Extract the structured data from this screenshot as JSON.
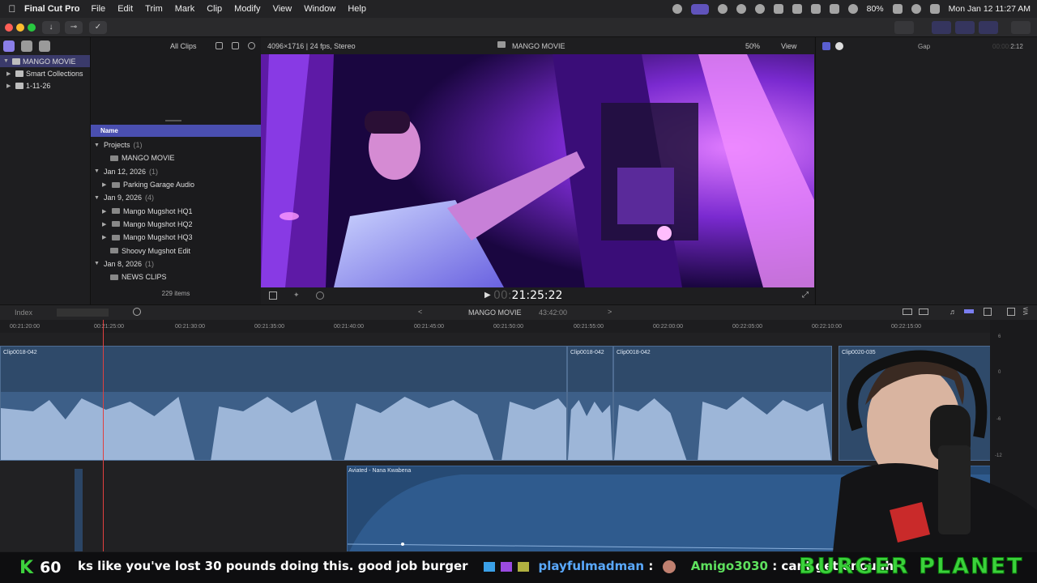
{
  "menubar": {
    "app_name": "Final Cut Pro",
    "menus": [
      "File",
      "Edit",
      "Trim",
      "Mark",
      "Clip",
      "Modify",
      "View",
      "Window",
      "Help"
    ],
    "battery": "80%",
    "clock": "Mon Jan 12  11:27 AM"
  },
  "library": {
    "items": [
      {
        "label": "MANGO MOVIE",
        "selected": true
      },
      {
        "label": "Smart Collections",
        "selected": false
      },
      {
        "label": "1-11-26",
        "selected": false
      }
    ]
  },
  "browser": {
    "filter": "All Clips",
    "column_header": "Name",
    "rows": [
      {
        "label": "Projects",
        "count": "(1)",
        "kind": "group"
      },
      {
        "label": "MANGO MOVIE",
        "count": "",
        "kind": "project"
      },
      {
        "label": "Jan 12, 2026",
        "count": "(1)",
        "kind": "group"
      },
      {
        "label": "Parking Garage Audio",
        "count": "",
        "kind": "clip"
      },
      {
        "label": "Jan 9, 2026",
        "count": "(4)",
        "kind": "group"
      },
      {
        "label": "Mango Mugshot HQ1",
        "count": "",
        "kind": "clip"
      },
      {
        "label": "Mango Mugshot HQ2",
        "count": "",
        "kind": "clip"
      },
      {
        "label": "Mango Mugshot HQ3",
        "count": "",
        "kind": "clip"
      },
      {
        "label": "Shoovy Mugshot Edit",
        "count": "",
        "kind": "project"
      },
      {
        "label": "Jan 8, 2026",
        "count": "(1)",
        "kind": "group"
      },
      {
        "label": "NEWS CLIPS",
        "count": "",
        "kind": "project"
      }
    ],
    "footer": "229 items"
  },
  "viewer": {
    "format": "4096×1716 | 24 fps, Stereo",
    "title": "MANGO MOVIE",
    "zoom": "50%",
    "view_label": "View",
    "timecode_dim": "00:",
    "timecode": "21:25:22"
  },
  "inspector": {
    "title": "Gap",
    "duration_dim": "00:00:",
    "duration": "2:12"
  },
  "timeline": {
    "index_label": "Index",
    "project": "MANGO MOVIE",
    "duration": "43:42:00",
    "ruler_labels": [
      "00:21:20:00",
      "00:21:25:00",
      "00:21:30:00",
      "00:21:35:00",
      "00:21:40:00",
      "00:21:45:00",
      "00:21:50:00",
      "00:21:55:00",
      "00:22:00:00",
      "00:22:05:00",
      "00:22:10:00",
      "00:22:15:00"
    ],
    "clips": [
      {
        "name": "Clip0018-042"
      },
      {
        "name": "Clip0018-042"
      },
      {
        "name": "Clip0018-042"
      },
      {
        "name": "Clip0020-035"
      }
    ],
    "music_clip": "Aviated - Nana Kwabena",
    "meter_labels": [
      "6",
      "0",
      "-6",
      "-12"
    ]
  },
  "stream_overlay": {
    "counter_letter": "K",
    "counter_value": "60",
    "chat_text_1": "ks like you've lost 30 pounds doing this. good job burger",
    "chat_user_1": "playfulmadman",
    "chat_sep_1": " : ",
    "chat_user_2": "Amigo3030",
    "chat_text_2": " : cant get enough",
    "brand": "BURGER PLANET"
  },
  "colors": {
    "accent": "#5a5fd0",
    "clip_blue": "#2f4a6a",
    "playhead": "#e04040",
    "banner_green": "#3bd13b"
  }
}
